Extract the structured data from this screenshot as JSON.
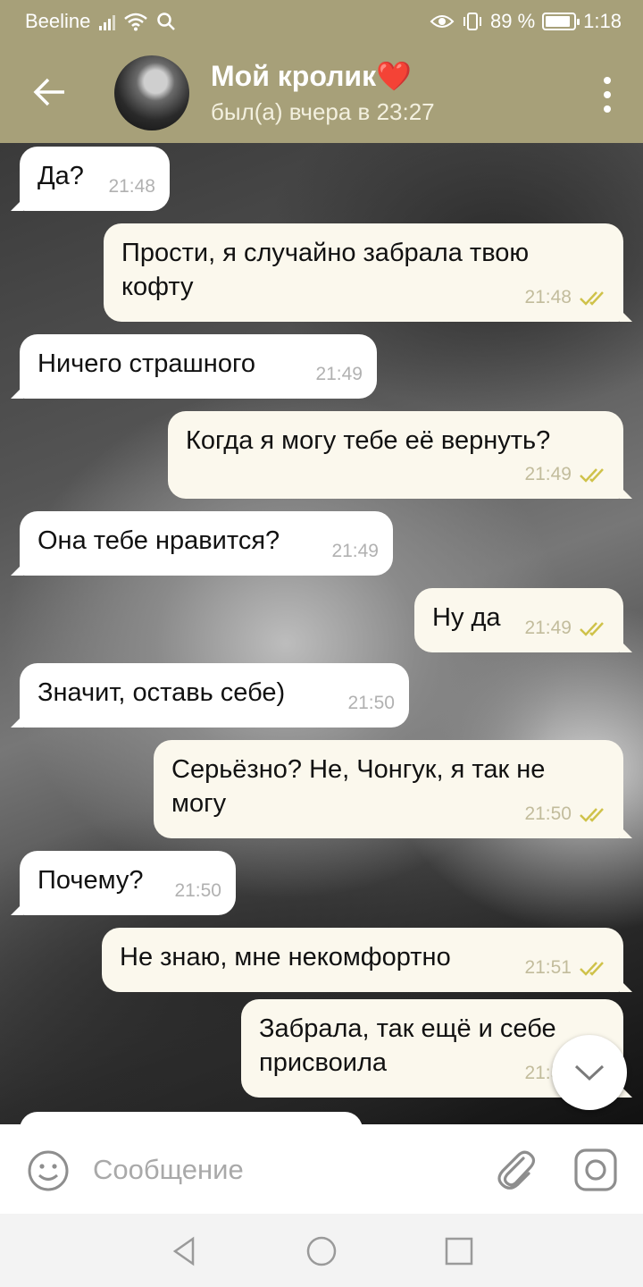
{
  "status_bar": {
    "carrier": "Beeline",
    "battery": "89 %",
    "battery_level": 0.89,
    "time": "1:18",
    "icons": [
      "signal-icon",
      "wifi-icon",
      "search-icon",
      "eye-icon",
      "vibrate-icon",
      "battery-icon"
    ]
  },
  "header": {
    "back_icon": "arrow-left-icon",
    "contact_name": "Мой кролик❤️",
    "contact_status": "был(а) вчера в 23:27",
    "menu_icon": "more-vertical-icon"
  },
  "messages": [
    {
      "direction": "in",
      "text": "Да?",
      "time": "21:48"
    },
    {
      "direction": "out",
      "text": "Прости, я случайно забрала твою кофту",
      "time": "21:48",
      "read": true
    },
    {
      "direction": "in",
      "text": "Ничего страшного",
      "time": "21:49"
    },
    {
      "direction": "out",
      "text": "Когда я могу тебе её вернуть?",
      "time": "21:49",
      "read": true
    },
    {
      "direction": "in",
      "text": "Она тебе нравится?",
      "time": "21:49"
    },
    {
      "direction": "out",
      "text": "Ну да",
      "time": "21:49",
      "read": true
    },
    {
      "direction": "in",
      "text": "Значит, оставь себе)",
      "time": "21:50"
    },
    {
      "direction": "out",
      "text": "Серьёзно? Не, Чонгук, я так не могу",
      "time": "21:50",
      "read": true
    },
    {
      "direction": "in",
      "text": "Почему?",
      "time": "21:50"
    },
    {
      "direction": "out",
      "text": "Не знаю, мне некомфортно",
      "time": "21:51",
      "read": true
    },
    {
      "direction": "out",
      "text": "Забрала, так ещё и себе присвоила",
      "time": "21:51",
      "read": true
    }
  ],
  "input": {
    "placeholder": "Сообщение",
    "value": ""
  },
  "colors": {
    "header_bg": "#a7a079",
    "outgoing_bubble": "#fbf8ed",
    "incoming_bubble": "#ffffff",
    "ticks": "#cfc24a"
  }
}
